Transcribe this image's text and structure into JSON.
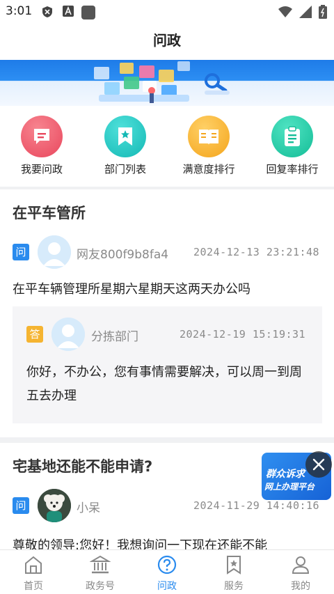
{
  "status_bar": {
    "time": "3:01",
    "icons": [
      "shield-icon",
      "a-icon",
      "square-icon",
      "wifi-icon",
      "signal-icon",
      "battery-icon"
    ]
  },
  "header": {
    "title": "问政"
  },
  "quick_nav": [
    {
      "label": "我要问政",
      "icon": "message-icon",
      "color": "#ef5a6e"
    },
    {
      "label": "部门列表",
      "icon": "bookmark-star-icon",
      "color": "#1cc7c2"
    },
    {
      "label": "满意度排行",
      "icon": "book-icon",
      "color": "#f6b531"
    },
    {
      "label": "回复率排行",
      "icon": "clipboard-icon",
      "color": "#20c6a2"
    }
  ],
  "questions": [
    {
      "title": "在平车管所",
      "tag": "问",
      "user": "网友800f9b8fa4",
      "time": "2024-12-13  23:21:48",
      "body": "在平车辆管理所星期六星期天这两天办公吗",
      "answer": {
        "tag": "答",
        "dept": "分拣部门",
        "time": "2024-12-19  15:19:31",
        "body": "你好，不办公，您有事情需要解决，可以周一到周五去办理"
      }
    },
    {
      "title": "宅基地还能不能申请?",
      "tag": "问",
      "user": "小呆",
      "time": "2024-11-29  14:40:16",
      "body": "尊敬的领导:您好！我想询问一下现在还能不能"
    }
  ],
  "float_promo": {
    "line1": "群众诉求",
    "line2": "网上办理平台"
  },
  "tabs": [
    {
      "label": "首页",
      "icon": "home-icon",
      "active": false
    },
    {
      "label": "政务号",
      "icon": "government-building-icon",
      "active": false
    },
    {
      "label": "问政",
      "icon": "question-circle-icon",
      "active": true
    },
    {
      "label": "服务",
      "icon": "service-bookmark-icon",
      "active": false
    },
    {
      "label": "我的",
      "icon": "user-icon",
      "active": false
    }
  ],
  "colors": {
    "accent": "#2a8bee",
    "answer_tag": "#f5b431",
    "muted_text": "#8a8a8a"
  }
}
